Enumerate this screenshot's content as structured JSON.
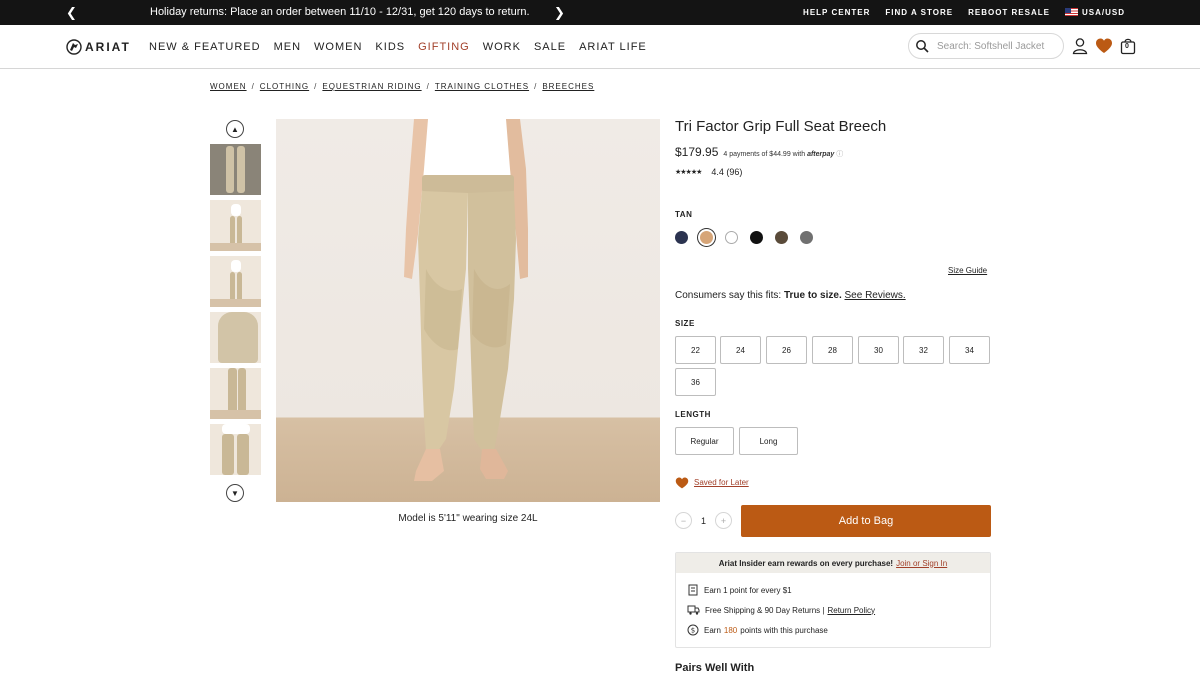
{
  "promo": {
    "prev_icon": "chevron-left-icon",
    "next_icon": "chevron-right-icon",
    "message": "Holiday returns: Place an order between 11/10 - 12/31, get 120 days to return.",
    "utility_links": [
      "HELP CENTER",
      "FIND A STORE",
      "REBOOT RESALE"
    ],
    "locale": "USA/USD"
  },
  "header": {
    "logo_text": "ARIAT",
    "nav": [
      "NEW & FEATURED",
      "MEN",
      "WOMEN",
      "KIDS",
      "GIFTING",
      "WORK",
      "SALE",
      "ARIAT LIFE"
    ],
    "search_placeholder": "Search: Softshell Jacket",
    "bag_count": "0",
    "accent_color": "#bb5a14"
  },
  "breadcrumb": [
    "WOMEN",
    "CLOTHING",
    "EQUESTRIAN RIDING",
    "TRAINING CLOTHES",
    "BREECHES"
  ],
  "gallery": {
    "caption": "Model is 5'11\" wearing size 24L",
    "thumb_count": 6
  },
  "product": {
    "title": "Tri Factor Grip Full Seat Breech",
    "price": "$179.95",
    "afterpay_text": "4 payments of $44.99 with",
    "afterpay_brand": "afterpay",
    "stars": "★★★★★",
    "rating": "4.4 (96)",
    "color_label": "TAN",
    "swatches": [
      "#2b3350",
      "#d6a578",
      "#ffffff",
      "#111111",
      "#5a4b3a",
      "#707070"
    ],
    "size_guide": "Size Guide",
    "fit_prefix": "Consumers say this fits:",
    "fit_value": "True to size.",
    "fit_link": "See Reviews.",
    "size_label": "SIZE",
    "sizes": [
      "22",
      "24",
      "26",
      "28",
      "30",
      "32",
      "34",
      "36"
    ],
    "length_label": "LENGTH",
    "lengths": [
      "Regular",
      "Long"
    ],
    "saved_label": "Saved for Later",
    "qty": "1",
    "add_to_bag": "Add to Bag"
  },
  "insider": {
    "headline": "Ariat Insider earn rewards on every purchase!",
    "link": "Join or Sign In",
    "perk1": "Earn 1 point for every $1",
    "perk2": "Free Shipping & 90 Day Returns |",
    "perk2_link": "Return Policy",
    "perk3_pre": "Earn",
    "perk3_points": "180",
    "perk3_post": "points with this purchase"
  },
  "pairs_heading": "Pairs Well With"
}
